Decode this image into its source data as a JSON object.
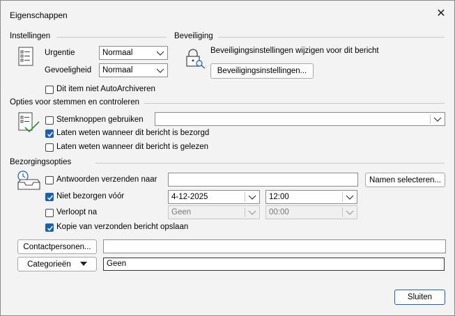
{
  "title": "Eigenschappen",
  "close_symbol": "✕",
  "settings": {
    "header": "Instellingen",
    "urgency_label": "Urgentie",
    "urgency_value": "Normaal",
    "sensitivity_label": "Gevoeligheid",
    "sensitivity_value": "Normaal",
    "no_autoarchive_label": "Dit item niet AutoArchiveren",
    "no_autoarchive_checked": false
  },
  "security": {
    "header": "Beveiliging",
    "description": "Beveiligingsinstellingen wijzigen voor dit bericht",
    "button": "Beveiligingsinstellingen..."
  },
  "voting": {
    "header": "Opties voor stemmen en controleren",
    "use_voting_label": "Stemknoppen gebruiken",
    "use_voting_checked": false,
    "voting_value": "",
    "delivered_label": "Laten weten wanneer dit bericht is bezorgd",
    "delivered_checked": true,
    "read_label": "Laten weten wanneer dit bericht is gelezen",
    "read_checked": false
  },
  "delivery": {
    "header": "Bezorgingsopties",
    "replies_label": "Antwoorden verzenden naar",
    "replies_checked": false,
    "replies_value": "",
    "select_names_button": "Namen selecteren...",
    "not_before_label": "Niet bezorgen vóór",
    "not_before_checked": true,
    "not_before_date": "4-12-2025",
    "not_before_time": "12:00",
    "expires_label": "Verloopt na",
    "expires_checked": false,
    "expires_date": "Geen",
    "expires_time": "00:00",
    "save_copy_label": "Kopie van verzonden bericht opslaan",
    "save_copy_checked": true
  },
  "contacts_button": "Contactpersonen...",
  "contacts_value": "",
  "categories_button": "Categorieën",
  "categories_value": "Geen",
  "close_button": "Sluiten",
  "icons": [
    "settings-list-icon",
    "lock-key-icon",
    "voting-check-icon",
    "delivery-clock-tray-icon",
    "chevron-down-icon",
    "checkmark-icon"
  ],
  "colors": {
    "accent": "#1a5fb4",
    "dialog_bg": "#f3f3f3",
    "field_border": "#8c8c8c"
  }
}
